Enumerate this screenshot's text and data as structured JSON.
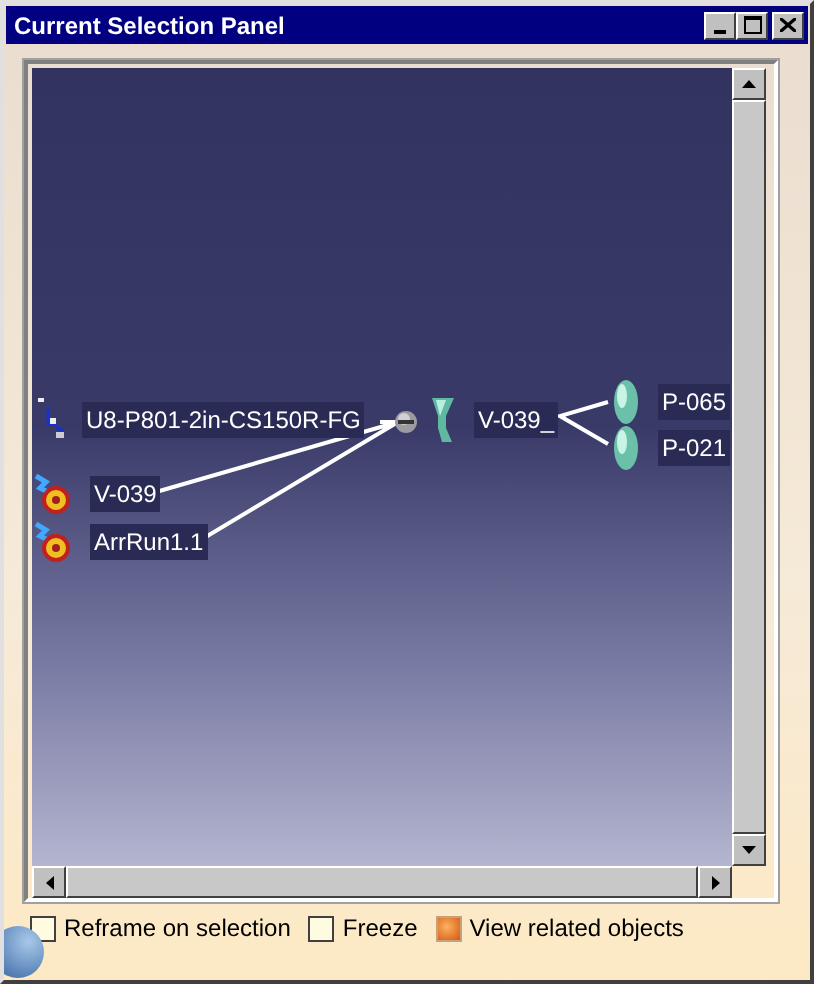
{
  "window": {
    "title": "Current Selection Panel"
  },
  "graph": {
    "nodes": [
      {
        "kind": "pipe",
        "label": "U8-P801-2in-CS150R-FG"
      },
      {
        "kind": "connector"
      },
      {
        "kind": "valve",
        "label": "V-039_"
      },
      {
        "kind": "part",
        "label": "P-065"
      },
      {
        "kind": "part",
        "label": "P-021"
      },
      {
        "kind": "run",
        "label": "V-039"
      },
      {
        "kind": "run",
        "label": "ArrRun1.1"
      }
    ]
  },
  "options": [
    {
      "label": "Reframe on selection",
      "checked": false
    },
    {
      "label": "Freeze",
      "checked": false
    },
    {
      "label": "View related objects",
      "checked": true
    }
  ]
}
